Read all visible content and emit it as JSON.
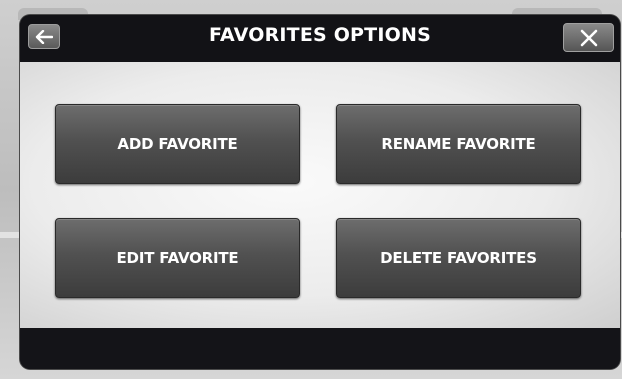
{
  "dialog": {
    "title": "FAVORITES OPTIONS",
    "back_icon": "arrow-left-icon",
    "close_icon": "close-x-icon"
  },
  "options": {
    "add_label": "ADD FAVORITE",
    "rename_label": "RENAME FAVORITE",
    "edit_label": "EDIT FAVORITE",
    "delete_label": "DELETE FAVORITES"
  },
  "colors": {
    "dialog_frame": "#111115",
    "button_top": "#6d6d6d",
    "button_bottom": "#3c3c3c",
    "content_background": "#ececec",
    "text": "#ffffff"
  }
}
